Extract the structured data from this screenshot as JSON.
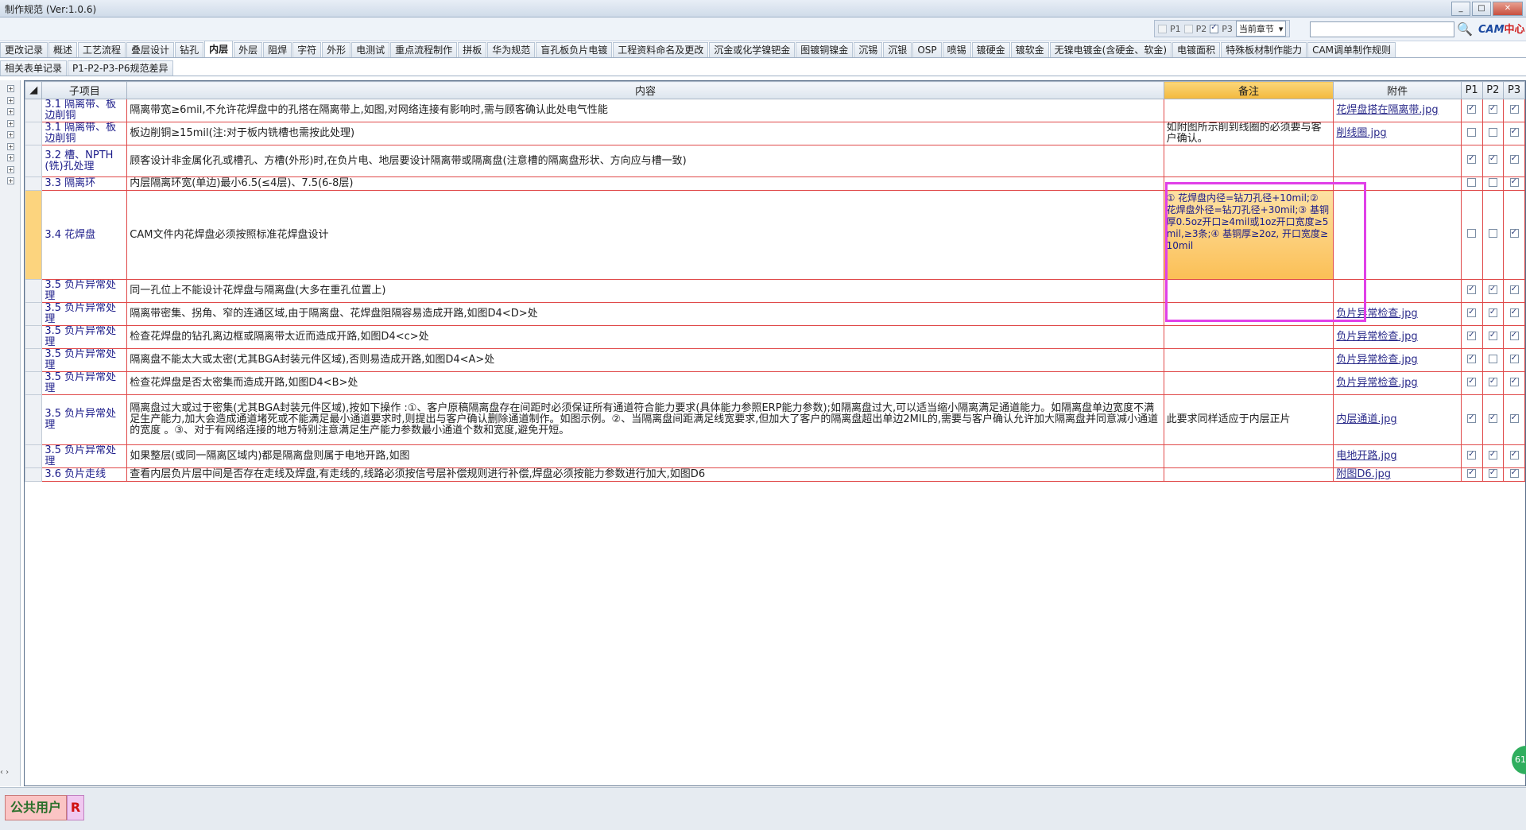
{
  "window": {
    "title": "制作规范 (Ver:1.0.6)",
    "min": "_",
    "max": "□",
    "close": "✕"
  },
  "toolbar": {
    "p1_label": "P1",
    "p2_label": "P2",
    "p3_label": "P3",
    "scope_value": "当前章节",
    "search_value": "",
    "search_glyph": "🔍",
    "logo_a": "CAM",
    "logo_b": "中心"
  },
  "tabs_row1": [
    "更改记录",
    "概述",
    "工艺流程",
    "叠层设计",
    "钻孔",
    "内层",
    "外层",
    "阻焊",
    "字符",
    "外形",
    "电测试",
    "重点流程制作",
    "拼板",
    "华为规范",
    "盲孔板负片电镀",
    "工程资料命名及更改",
    "沉金或化学镍钯金",
    "图镀铜镍金",
    "沉锡",
    "沉银",
    "OSP",
    "喷锡",
    "镀硬金",
    "镀软金",
    "无镍电镀金(含硬金、软金)",
    "电镀面积",
    "特殊板材制作能力",
    "CAM调单制作规则"
  ],
  "tabs_row2": [
    "相关表单记录",
    "P1-P2-P3-P6规范差异"
  ],
  "active_tab": "内层",
  "grid": {
    "headers": {
      "sub": "子项目",
      "content": "内容",
      "note": "备注",
      "attach": "附件",
      "p1": "P1",
      "p2": "P2",
      "p3": "P3"
    },
    "rows": [
      {
        "sub": "3.1 隔离带、板边削铜",
        "content": "隔离带宽≥6mil,不允许花焊盘中的孔搭在隔离带上,如图,对网络连接有影响时,需与顾客确认此处电气性能",
        "note": "",
        "attach": "花焊盘搭在隔离带.jpg",
        "p1": true,
        "p2": true,
        "p3": true
      },
      {
        "sub": "3.1 隔离带、板边削铜",
        "content": "板边削铜≥15mil(注:对于板内铣槽也需按此处理)",
        "note": "如附图所示削到线圈的必须要与客户确认。",
        "attach": "削线圈.jpg",
        "p1": false,
        "p2": false,
        "p3": true
      },
      {
        "sub": "3.2 槽、NPTH(铣)孔处理",
        "content": "顾客设计非金属化孔或槽孔、方槽(外形)时,在负片电、地层要设计隔离带或隔离盘(注意槽的隔离盘形状、方向应与槽一致)",
        "note": "",
        "attach": "",
        "p1": true,
        "p2": true,
        "p3": true
      },
      {
        "sub": "3.3 隔离环",
        "content": "内层隔离环宽(单边)最小6.5(≤4层)、7.5(6-8层)",
        "note": "",
        "attach": "",
        "p1": false,
        "p2": false,
        "p3": true
      },
      {
        "sub": "3.4 花焊盘",
        "content": "CAM文件内花焊盘必须按照标准花焊盘设计",
        "note": "① 花焊盘内径=钻刀孔径+10mil;② 花焊盘外径=钻刀孔径+30mil;③ 基铜厚0.5oz开口≥4mil或1oz开口宽度≥5mil,≥3条;④ 基铜厚≥2oz, 开口宽度≥10mil",
        "attach": "",
        "p1": false,
        "p2": false,
        "p3": true
      },
      {
        "sub": "3.5 负片异常处理",
        "content": "同一孔位上不能设计花焊盘与隔离盘(大多在重孔位置上)",
        "note": "",
        "attach": "",
        "p1": true,
        "p2": true,
        "p3": true
      },
      {
        "sub": "3.5 负片异常处理",
        "content": "隔离带密集、拐角、窄的连通区域,由于隔离盘、花焊盘阻隔容易造成开路,如图D4<D>处",
        "note": "",
        "attach": "负片异常检查.jpg",
        "p1": true,
        "p2": true,
        "p3": true
      },
      {
        "sub": "3.5 负片异常处理",
        "content": "检查花焊盘的钻孔离边框或隔离带太近而造成开路,如图D4<c>处",
        "note": "",
        "attach": "负片异常检查.jpg",
        "p1": true,
        "p2": true,
        "p3": true
      },
      {
        "sub": "3.5 负片异常处理",
        "content": "隔离盘不能太大或太密(尤其BGA封装元件区域),否则易造成开路,如图D4<A>处",
        "note": "",
        "attach": "负片异常检查.jpg",
        "p1": true,
        "p2": false,
        "p3": true
      },
      {
        "sub": "3.5 负片异常处理",
        "content": "检查花焊盘是否太密集而造成开路,如图D4<B>处",
        "note": "",
        "attach": "负片异常检查.jpg",
        "p1": true,
        "p2": true,
        "p3": true
      },
      {
        "sub": "3.5 负片异常处理",
        "content": "隔离盘过大或过于密集(尤其BGA封装元件区域),按如下操作 :①、客户原稿隔离盘存在间距时必须保证所有通道符合能力要求(具体能力参照ERP能力参数);如隔离盘过大,可以适当缩小隔离满足通道能力。如隔离盘单边宽度不满足生产能力,加大会造成通道堵死或不能满足最小通道要求时,则提出与客户确认删除通道制作。如图示例。②、当隔离盘间距满足线宽要求,但加大了客户的隔离盘超出单边2MIL的,需要与客户确认允许加大隔离盘并同意减小通道的宽度 。③、对于有网络连接的地方特别注意满足生产能力参数最小通道个数和宽度,避免开短。",
        "note": "此要求同样适应于内层正片",
        "attach": "内层通道.jpg",
        "p1": true,
        "p2": true,
        "p3": true
      },
      {
        "sub": "3.5 负片异常处理",
        "content": "如果整层(或同一隔离区域内)都是隔离盘则属于电地开路,如图",
        "note": "",
        "attach": "电地开路.jpg",
        "p1": true,
        "p2": true,
        "p3": true
      },
      {
        "sub": "3.6 负片走线",
        "content": "查看内层负片层中间是否存在走线及焊盘,有走线的,线路必须按信号层补偿规则进行补偿,焊盘必须按能力参数进行加大,如图D6",
        "note": "",
        "attach": "附图D6.jpg",
        "p1": true,
        "p2": true,
        "p3": true
      }
    ]
  },
  "status": {
    "user": "公共用户",
    "badge": "R",
    "bubble": "61"
  }
}
